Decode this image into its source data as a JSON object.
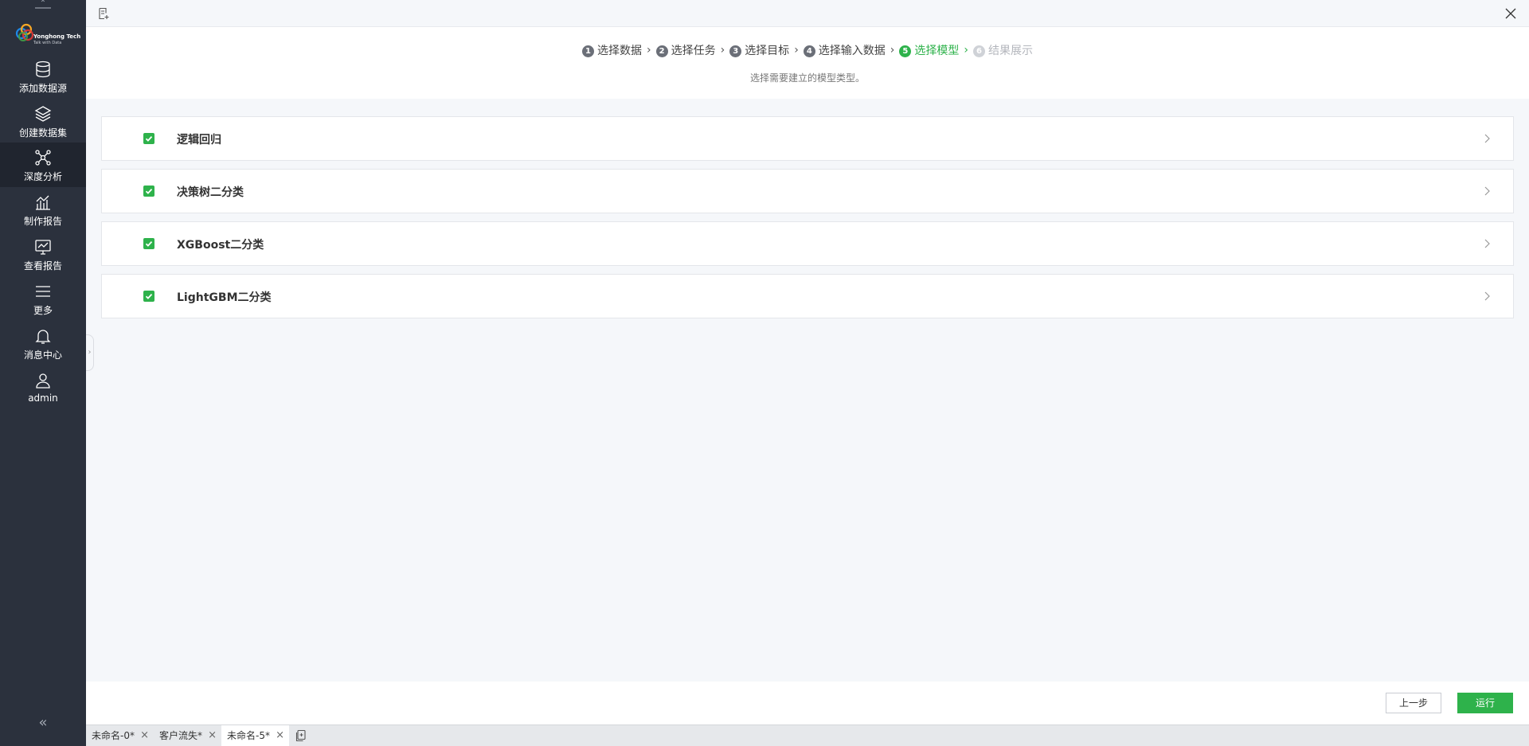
{
  "sidebar": {
    "logo": {
      "brand": "Yonghong Tech",
      "tagline": "Talk with Data"
    },
    "items": [
      {
        "label": "添加数据源",
        "icon": "database-icon"
      },
      {
        "label": "创建数据集",
        "icon": "layers-icon"
      },
      {
        "label": "深度分析",
        "icon": "network-icon",
        "active": true
      },
      {
        "label": "制作报告",
        "icon": "bar-chart-icon"
      },
      {
        "label": "查看报告",
        "icon": "monitor-chart-icon"
      },
      {
        "label": "更多",
        "icon": "menu-icon"
      },
      {
        "label": "消息中心",
        "icon": "bell-icon"
      },
      {
        "label": "admin",
        "icon": "user-icon"
      }
    ],
    "collapse": "«"
  },
  "steps": [
    {
      "num": "1",
      "label": "选择数据",
      "state": "done"
    },
    {
      "num": "2",
      "label": "选择任务",
      "state": "done"
    },
    {
      "num": "3",
      "label": "选择目标",
      "state": "done"
    },
    {
      "num": "4",
      "label": "选择输入数据",
      "state": "done"
    },
    {
      "num": "5",
      "label": "选择模型",
      "state": "active"
    },
    {
      "num": "6",
      "label": "结果展示",
      "state": "disabled"
    }
  ],
  "steps_hint": "选择需要建立的模型类型。",
  "models": [
    {
      "name": "逻辑回归",
      "checked": true
    },
    {
      "name": "决策树二分类",
      "checked": true
    },
    {
      "name": "XGBoost二分类",
      "checked": true
    },
    {
      "name": "LightGBM二分类",
      "checked": true
    }
  ],
  "actions": {
    "prev": "上一步",
    "run": "运行"
  },
  "tabs": [
    {
      "label": "未命名-0*",
      "active": false
    },
    {
      "label": "客户流失*",
      "active": false
    },
    {
      "label": "未命名-5*",
      "active": true
    }
  ],
  "colors": {
    "accent": "#2eb24b",
    "sidebar": "#2b313d"
  }
}
